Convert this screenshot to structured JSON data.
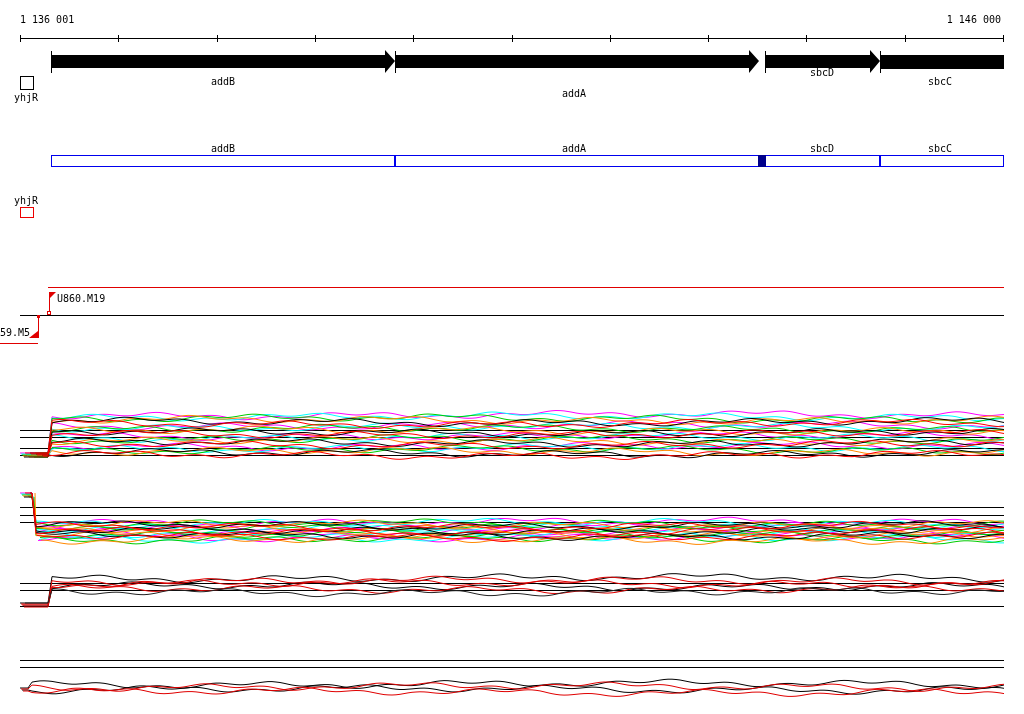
{
  "ruler": {
    "start_label": "1 136 001",
    "end_label": "1 146 000"
  },
  "gene_track": {
    "genes": [
      {
        "label": "addB",
        "kind": "arrow"
      },
      {
        "label": "addA",
        "kind": "arrow"
      },
      {
        "label": "sbcD",
        "kind": "arrow"
      },
      {
        "label": "sbcC",
        "kind": "bar"
      }
    ],
    "side_gene": {
      "label": "yhjR"
    }
  },
  "annotation_track": {
    "genes": [
      {
        "label": "addB"
      },
      {
        "label": "addA"
      },
      {
        "label": "sbcD"
      },
      {
        "label": "sbcC"
      }
    ],
    "side_gene": {
      "label": "yhjR"
    }
  },
  "markers": [
    {
      "label": "U860.M19"
    },
    {
      "label": "59.M5"
    }
  ]
}
